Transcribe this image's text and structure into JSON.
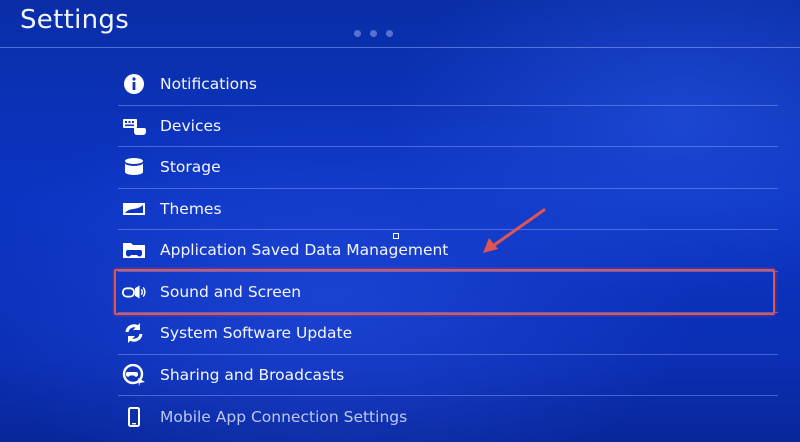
{
  "header": {
    "title": "Settings"
  },
  "menu": {
    "items": [
      {
        "label": "Notifications",
        "icon": "info-icon"
      },
      {
        "label": "Devices",
        "icon": "devices-icon"
      },
      {
        "label": "Storage",
        "icon": "storage-icon"
      },
      {
        "label": "Themes",
        "icon": "themes-icon"
      },
      {
        "label": "Application Saved Data Management",
        "icon": "saved-data-icon"
      },
      {
        "label": "Sound and Screen",
        "icon": "sound-screen-icon",
        "highlighted": true
      },
      {
        "label": "System Software Update",
        "icon": "update-icon"
      },
      {
        "label": "Sharing and Broadcasts",
        "icon": "sharing-icon"
      },
      {
        "label": "Mobile App Connection Settings",
        "icon": "mobile-icon"
      }
    ]
  },
  "annotation": {
    "highlight_color": "#e0554f",
    "arrow_color": "#e0554f"
  }
}
